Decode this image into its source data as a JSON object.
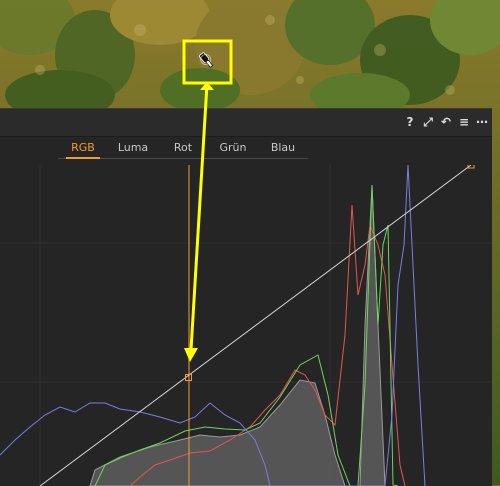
{
  "colors": {
    "accent": "#f39b2f",
    "callout": "#ffff00",
    "red": "#e0584f",
    "green": "#6fd35c",
    "blue": "#7a7ee0",
    "luma_fill": "#7b7b7b"
  },
  "panel": {
    "icons": [
      {
        "name": "help-icon",
        "glyph": "?"
      },
      {
        "name": "expand-icon",
        "glyph": "⤢"
      },
      {
        "name": "reset-icon",
        "glyph": "↶"
      },
      {
        "name": "menu-icon",
        "glyph": "≡"
      },
      {
        "name": "more-icon",
        "glyph": "⋯"
      }
    ]
  },
  "tabs": [
    {
      "label": "RGB",
      "active": true
    },
    {
      "label": "Luma",
      "active": false
    },
    {
      "label": "Rot",
      "active": false
    },
    {
      "label": "Grün",
      "active": false
    },
    {
      "label": "Blau",
      "active": false
    }
  ],
  "tool": {
    "name": "eyedropper-icon"
  }
}
